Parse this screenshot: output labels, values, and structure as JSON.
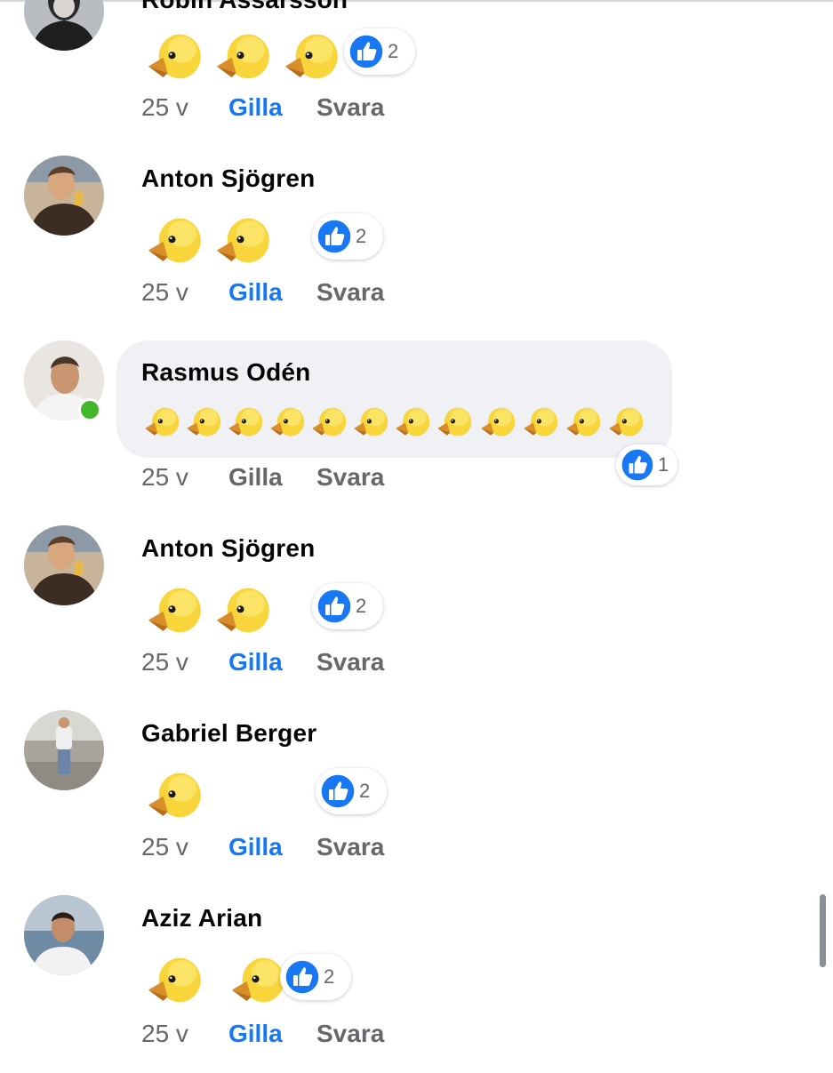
{
  "actions": {
    "like": "Gilla",
    "reply": "Svara"
  },
  "comments": [
    {
      "name": "Robin Assarsson",
      "time": "25 v",
      "liked": true,
      "online": false,
      "chicks": 3,
      "reactions": "2",
      "bubble": false
    },
    {
      "name": "Anton Sjögren",
      "time": "25 v",
      "liked": true,
      "online": false,
      "chicks": 2,
      "reactions": "2",
      "bubble": false
    },
    {
      "name": "Rasmus Odén",
      "time": "25 v",
      "liked": false,
      "online": true,
      "chicks": 12,
      "reactions": "1",
      "bubble": true
    },
    {
      "name": "Anton Sjögren",
      "time": "25 v",
      "liked": true,
      "online": false,
      "chicks": 2,
      "reactions": "2",
      "bubble": false
    },
    {
      "name": "Gabriel Berger",
      "time": "25 v",
      "liked": true,
      "online": false,
      "chicks": 1,
      "reactions": "2",
      "bubble": false
    },
    {
      "name": "Aziz Arian",
      "time": "25 v",
      "liked": true,
      "online": false,
      "chicks": 2,
      "reactions": "2",
      "bubble": false
    }
  ],
  "colors": {
    "accent": "#1877f2",
    "online": "#42b72a",
    "bubble": "#eff1f4",
    "muted": "#65676b"
  },
  "icons": {
    "emoji": "baby-chick-emoji",
    "reaction": "like-thumbs-up-icon"
  }
}
